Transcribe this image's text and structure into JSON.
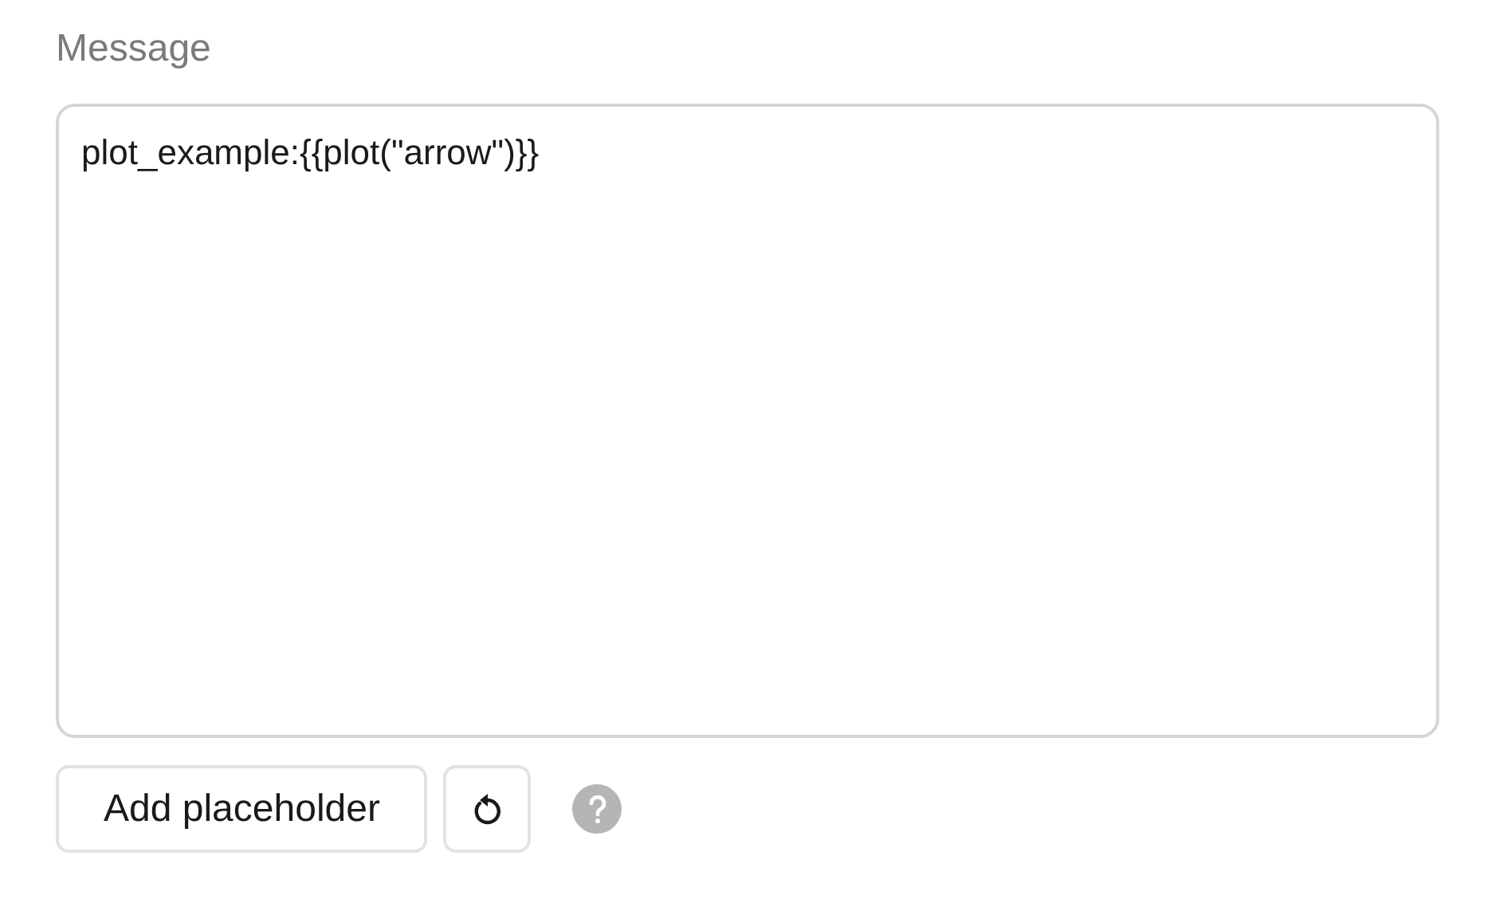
{
  "field": {
    "label": "Message",
    "value": "plot_example:{{plot(\"arrow\")}}"
  },
  "buttons": [
    {
      "kind": "text",
      "label": "Add placeholder"
    },
    {
      "kind": "reset"
    },
    {
      "kind": "help"
    }
  ]
}
